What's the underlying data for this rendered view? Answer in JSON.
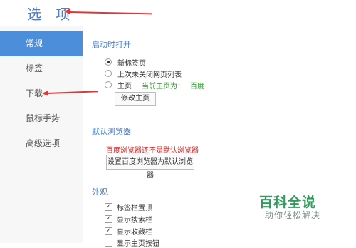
{
  "header": {
    "title": "选 项"
  },
  "sidebar": {
    "items": [
      {
        "label": "常规"
      },
      {
        "label": "标签"
      },
      {
        "label": "下载"
      },
      {
        "label": "鼠标手势"
      },
      {
        "label": "高级选项"
      }
    ],
    "active_index": 0
  },
  "startup": {
    "title": "启动时打开",
    "options": [
      {
        "label": "新标签页",
        "checked": true
      },
      {
        "label": "上次未关闭网页列表",
        "checked": false
      },
      {
        "label": "主页",
        "checked": false,
        "note": "当前主页为：",
        "value": "百度"
      }
    ],
    "edit_button": "修改主页"
  },
  "default_browser": {
    "title": "默认浏览器",
    "warning": "百度浏览器还不是默认浏览器",
    "set_button": "设置百度浏览器为默认浏览器"
  },
  "appearance": {
    "title": "外观",
    "checks": [
      {
        "label": "标签栏置顶",
        "checked": true
      },
      {
        "label": "显示搜索栏",
        "checked": true
      },
      {
        "label": "显示收藏栏",
        "checked": true
      },
      {
        "label": "显示主页按钮",
        "checked": false
      }
    ]
  },
  "watermark": {
    "title": "百科全说",
    "subtitle": "助你轻松解决"
  },
  "colors": {
    "accent": "#4d8edb",
    "annotation": "#e43434",
    "warning": "#e02020",
    "watermark": "#2f9b5d"
  }
}
